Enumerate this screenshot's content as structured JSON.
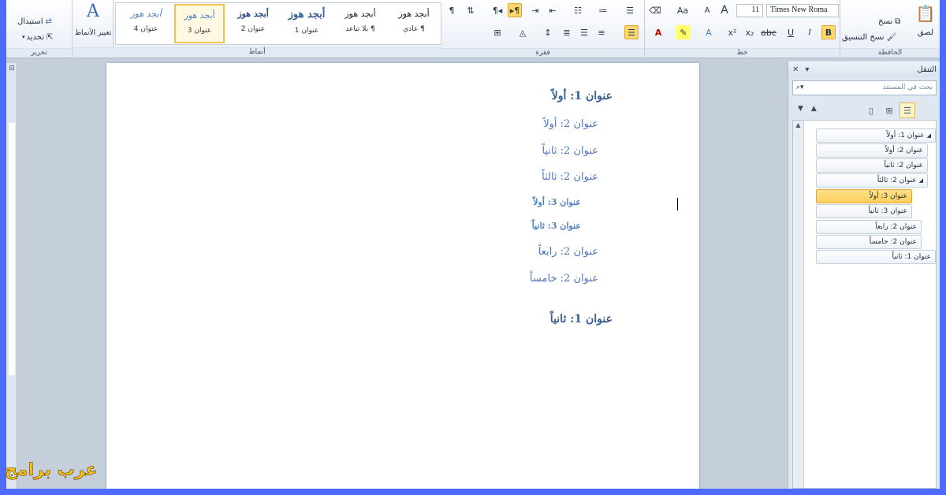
{
  "ribbon": {
    "editing": {
      "label": "تحرير",
      "replace": "استبدال",
      "select": "تحديد"
    },
    "styles": {
      "label": "أنماط",
      "change_styles": "تغيير الأنماط",
      "tiles": [
        {
          "sample": "أبجد هوز",
          "name": "¶ عادي"
        },
        {
          "sample": "أبجد هوز",
          "name": "¶ بلا تباعد"
        },
        {
          "sample": "أبجد هوز",
          "name": "عنوان 1"
        },
        {
          "sample": "أبجد هوز",
          "name": "عنوان 2"
        },
        {
          "sample": "أبجد هوز",
          "name": "عنوان 3"
        },
        {
          "sample": "أبجد هوز",
          "name": "عنوان 4"
        }
      ]
    },
    "paragraph": {
      "label": "فقرة"
    },
    "font": {
      "label": "خط",
      "font_name": "Times New Roma",
      "font_size": "11",
      "bold": "B",
      "italic": "I",
      "underline": "U"
    },
    "clipboard": {
      "label": "الحافظة",
      "paste": "لصق",
      "copy": "نسخ",
      "format_painter": "نسخ التنسيق"
    }
  },
  "document": {
    "headings": [
      {
        "level": 1,
        "text": "عنوان 1: أولاً"
      },
      {
        "level": 2,
        "text": "عنوان 2: أولاً"
      },
      {
        "level": 2,
        "text": "عنوان 2: ثانياً"
      },
      {
        "level": 2,
        "text": "عنوان 2: ثالثاً"
      },
      {
        "level": 3,
        "text": "عنوان 3: أولاً"
      },
      {
        "level": 3,
        "text": "عنوان 3: ثانياً"
      },
      {
        "level": 2,
        "text": "عنوان 2: رابعاً"
      },
      {
        "level": 2,
        "text": "عنوان 2: خامساً"
      },
      {
        "level": 1,
        "text": "عنوان 1: ثانياً"
      }
    ]
  },
  "navigation": {
    "title": "التنقل",
    "search_placeholder": "بحث في المستند",
    "tree": [
      {
        "text": "عنوان 1: أولاً",
        "expanded": true
      },
      {
        "text": "عنوان 2: أولاً"
      },
      {
        "text": "عنوان 2: ثانياً"
      },
      {
        "text": "عنوان 2: ثالثاً",
        "expanded": true
      },
      {
        "text": "عنوان 3: أولاً",
        "selected": true
      },
      {
        "text": "عنوان 3: ثانياً"
      },
      {
        "text": "عنوان 2: رابعاً"
      },
      {
        "text": "عنوان 2: خامساً"
      },
      {
        "text": "عنوان 1: ثانياً"
      }
    ]
  },
  "watermark": "عرب برامج",
  "colors": {
    "accent_selected": "#fbcf5b",
    "heading_blue": "#4f76b8",
    "background": "#4d6bff"
  }
}
